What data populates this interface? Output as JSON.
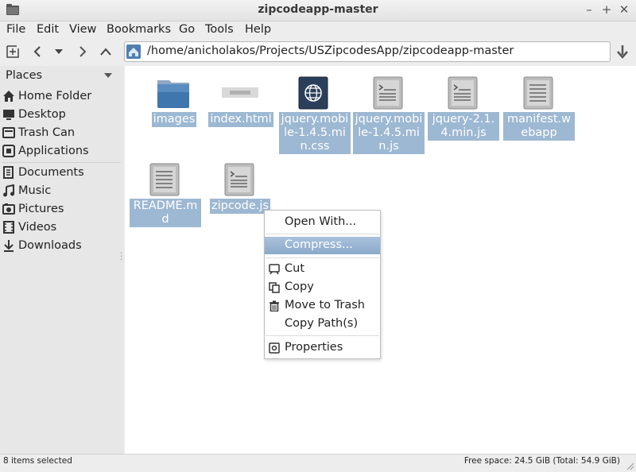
{
  "window": {
    "title": "zipcodeapp-master",
    "minimize": "–",
    "maximize": "+",
    "close": "✕"
  },
  "menubar": {
    "items": [
      "File",
      "Edit",
      "View",
      "Bookmarks",
      "Go",
      "Tools",
      "Help"
    ]
  },
  "location": {
    "path": "/home/anicholakos/Projects/USZipcodesApp/zipcodeapp-master"
  },
  "sidebar": {
    "heading": "Places",
    "items": [
      {
        "label": "Home Folder",
        "icon": "home-icon"
      },
      {
        "label": "Desktop",
        "icon": "desktop-icon"
      },
      {
        "label": "Trash Can",
        "icon": "trash-icon"
      },
      {
        "label": "Applications",
        "icon": "applications-icon"
      },
      {
        "label": "Documents",
        "icon": "documents-icon"
      },
      {
        "label": "Music",
        "icon": "music-icon"
      },
      {
        "label": "Pictures",
        "icon": "pictures-icon"
      },
      {
        "label": "Videos",
        "icon": "videos-icon"
      },
      {
        "label": "Downloads",
        "icon": "downloads-icon"
      }
    ]
  },
  "files": [
    {
      "name": "images",
      "kind": "folder"
    },
    {
      "name": "index.html",
      "kind": "html"
    },
    {
      "name": "jquery.mobile-1.4.5.min.css",
      "kind": "css"
    },
    {
      "name": "jquery.mobile-1.4.5.min.js",
      "kind": "script"
    },
    {
      "name": "jquery-2.1.4.min.js",
      "kind": "script"
    },
    {
      "name": "manifest.webapp",
      "kind": "text"
    },
    {
      "name": "README.md",
      "kind": "text"
    },
    {
      "name": "zipcode.js",
      "kind": "script"
    }
  ],
  "context_menu": {
    "items": [
      {
        "label": "Open With...",
        "icon": ""
      },
      {
        "label": "Compress...",
        "icon": "",
        "highlighted": true
      },
      {
        "label": "Cut",
        "icon": "cut-icon"
      },
      {
        "label": "Copy",
        "icon": "copy-icon"
      },
      {
        "label": "Move to Trash",
        "icon": "trash-icon"
      },
      {
        "label": "Copy Path(s)",
        "icon": ""
      },
      {
        "label": "Properties",
        "icon": "properties-icon"
      }
    ]
  },
  "status": {
    "selection": "8 items selected",
    "free_space": "Free space: 24.5 GiB (Total: 54.9 GiB)"
  },
  "colors": {
    "selection": "#9db8d2",
    "highlight": "#8aa9c9",
    "sidebar_bg": "#e7e7e7"
  }
}
